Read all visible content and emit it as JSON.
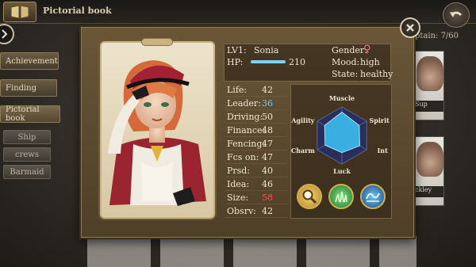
{
  "header": {
    "title": "Pictorial book"
  },
  "side_tabs": [
    "Achievement",
    "Finding",
    "Pictorial book"
  ],
  "sub_tabs": [
    "Ship",
    "crews",
    "Barmaid"
  ],
  "captain_text": "ptain: 7/60",
  "right_cards": [
    "Sup",
    "ckley"
  ],
  "character": {
    "level_label": "LV1:",
    "name": "Sonia",
    "hp_label": "HP:",
    "hp_value": "210",
    "hp_fraction": 0.95,
    "gender_label": "Gender:",
    "gender_symbol": "♀",
    "mood_label": "Mood:",
    "mood_value": "high",
    "state_label": "State:",
    "state_value": "healthy"
  },
  "stats": [
    {
      "label": "Life:",
      "value": "42",
      "color": "#efe6d2"
    },
    {
      "label": "Leader:",
      "value": "36",
      "color": "#7fc6ec"
    },
    {
      "label": "Driving:",
      "value": "50",
      "color": "#efe6d2"
    },
    {
      "label": "Finance:",
      "value": "48",
      "color": "#efe6d2"
    },
    {
      "label": "Fencing:",
      "value": "47",
      "color": "#efe6d2"
    },
    {
      "label": "Fcs on:",
      "value": "47",
      "color": "#efe6d2"
    },
    {
      "label": "Prsd:",
      "value": "40",
      "color": "#efe6d2"
    },
    {
      "label": "Idea:",
      "value": "46",
      "color": "#efe6d2"
    },
    {
      "label": "Size:",
      "value": "58",
      "color": "#ff5252"
    },
    {
      "label": "Obsrv:",
      "value": "42",
      "color": "#efe6d2"
    }
  ],
  "radar": {
    "labels": [
      "Muscle",
      "Spirit",
      "Int",
      "Luck",
      "Charm",
      "Agility"
    ],
    "values": [
      0.82,
      0.7,
      0.72,
      0.6,
      0.68,
      0.7
    ],
    "fill_color": "#3aaee0",
    "grid_color": "#2a2f5a"
  },
  "skills": [
    "magnifier-skill-icon",
    "grass-skill-icon",
    "water-skill-icon"
  ]
}
